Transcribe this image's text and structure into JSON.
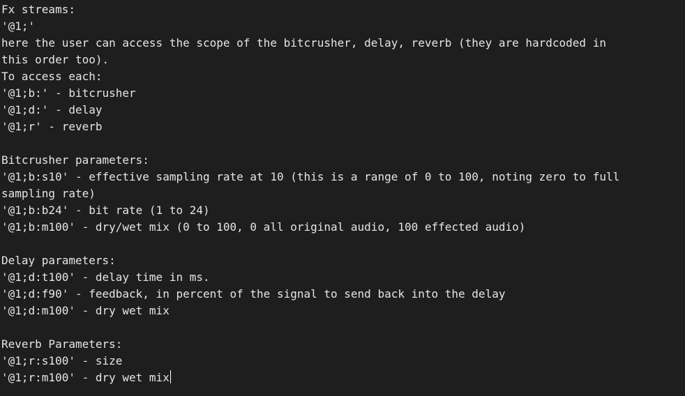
{
  "editor": {
    "lines": [
      "Fx streams:",
      "'@1;'",
      "here the user can access the scope of the bitcrusher, delay, reverb (they are hardcoded in",
      "this order too).",
      "To access each:",
      "'@1;b:' - bitcrusher",
      "'@1;d:' - delay",
      "'@1;r' - reverb",
      "",
      "Bitcrusher parameters:",
      "'@1;b:s10' - effective sampling rate at 10 (this is a range of 0 to 100, noting zero to full",
      "sampling rate)",
      "'@1;b:b24' - bit rate (1 to 24)",
      "'@1;b:m100' - dry/wet mix (0 to 100, 0 all original audio, 100 effected audio)",
      "",
      "Delay parameters:",
      "'@1;d:t100' - delay time in ms.",
      "'@1;d:f90' - feedback, in percent of the signal to send back into the delay",
      "'@1;d:m100' - dry wet mix",
      "",
      "Reverb Parameters:",
      "'@1;r:s100' - size",
      "'@1;r:m100' - dry wet mix"
    ]
  },
  "colors": {
    "background": "#1e1e1e",
    "text": "#e6e6e6",
    "cursor": "#ffffff"
  }
}
